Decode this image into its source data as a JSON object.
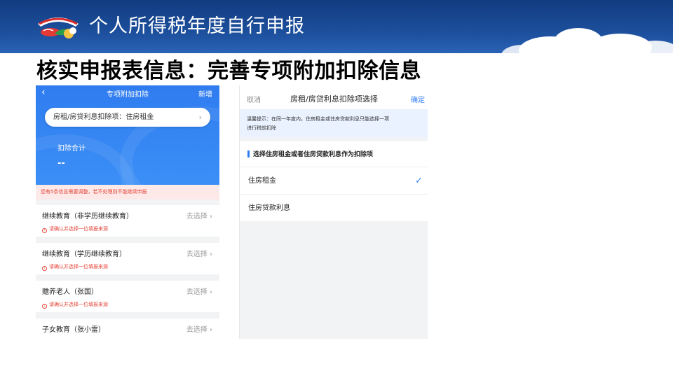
{
  "banner": {
    "title": "个人所得税年度自行申报"
  },
  "slide_subtitle": "核实申报表信息：完善专项附加扣除信息",
  "left_screen": {
    "nav": {
      "back_icon": "chevron-left-icon",
      "title": "专项附加扣除",
      "new_label": "新增"
    },
    "type_pill": {
      "label": "房租/房贷利息扣除项：住房租金",
      "chevron": "›"
    },
    "total": {
      "label": "扣除合计",
      "value": "--"
    },
    "warning": "您有5条信息需要调整，若不处理则不能继续申报",
    "items": [
      {
        "title": "继续教育（非学历继续教育）",
        "action": "去选择 ›",
        "tip": "请确认并选择一位填报来源"
      },
      {
        "title": "继续教育（学历继续教育）",
        "action": "去选择 ›",
        "tip": "请确认并选择一位填报来源"
      },
      {
        "title": "赡养老人（张国）",
        "action": "去选择 ›",
        "tip": "请确认并选择一位填报来源"
      },
      {
        "title": "子女教育（张小雷）",
        "action": "去选择 ›",
        "tip": ""
      }
    ]
  },
  "right_screen": {
    "nav": {
      "cancel": "取消",
      "title": "房租/房贷利息扣除项选择",
      "confirm": "确定"
    },
    "hint_line1": "温馨提示：在同一年度内，住房租金或住房贷款利息只能选择一项",
    "hint_line2": "进行税前扣除",
    "section_title": "选择住房租金或者住房贷款利息作为扣除项",
    "options": [
      {
        "label": "住房租金",
        "check": "✓"
      },
      {
        "label": "住房贷款利息",
        "check": ""
      }
    ]
  },
  "colors": {
    "brand_blue": "#2f7cf0",
    "banner_blue": "#1c4f9c",
    "warning_red": "#e4473c"
  }
}
